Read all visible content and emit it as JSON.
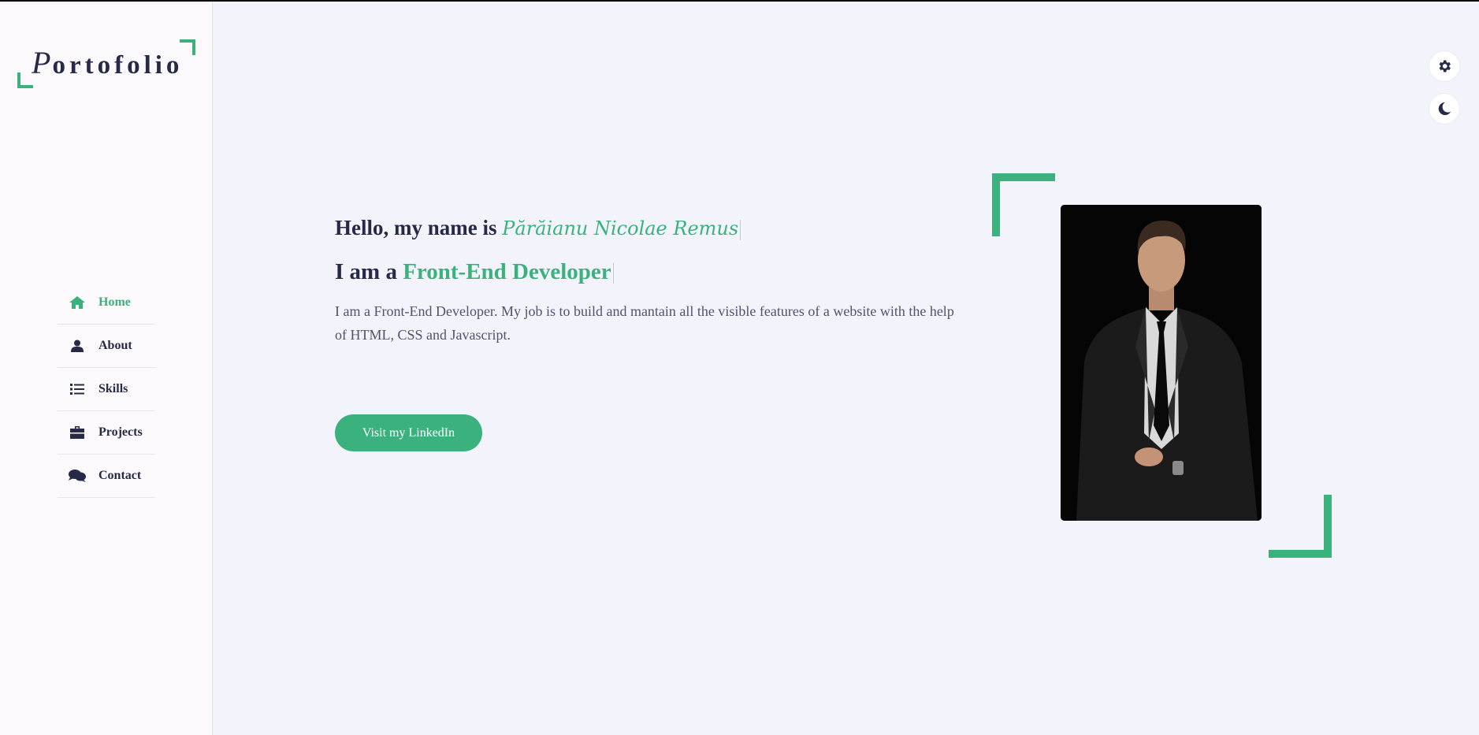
{
  "logo": {
    "first_letter": "P",
    "rest": "ortofolio"
  },
  "nav": [
    {
      "label": "Home",
      "icon": "home-icon",
      "active": true
    },
    {
      "label": "About",
      "icon": "user-icon",
      "active": false
    },
    {
      "label": "Skills",
      "icon": "list-icon",
      "active": false
    },
    {
      "label": "Projects",
      "icon": "briefcase-icon",
      "active": false
    },
    {
      "label": "Contact",
      "icon": "comments-icon",
      "active": false
    }
  ],
  "controls": {
    "settings_icon": "gear-icon",
    "theme_icon": "moon-icon"
  },
  "hero": {
    "greeting": "Hello, my name is ",
    "name": "Părăianu Nicolae Remus",
    "role_prefix": "I am a ",
    "role": "Front-End Developer",
    "description": "I am a Front-End Developer. My job is to build and mantain all the visible features of a website with the help of HTML, CSS and Javascript.",
    "cta_label": "Visit my LinkedIn"
  },
  "photo": {
    "subject": "man in dark suit portrait"
  },
  "colors": {
    "accent": "#3bb27e",
    "text": "#262a47",
    "background": "#f2f3fb",
    "sidebar": "#fcf9fd"
  }
}
